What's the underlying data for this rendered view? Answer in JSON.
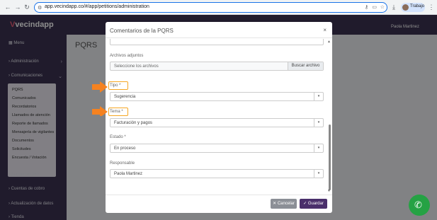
{
  "browser": {
    "url": "app.vecindapp.co/#/app/petitions/administration",
    "profile": "Trabajo"
  },
  "sidebar": {
    "logo": "vecindapp",
    "items": [
      {
        "label": "Menu"
      },
      {
        "label": "Administración"
      },
      {
        "label": "Comunicaciones"
      }
    ],
    "submenu": [
      "PQRS",
      "Comunicados",
      "Recordatorios",
      "Llamados de atención",
      "Reporte de llamados",
      "Mensajería de vigilantes",
      "Documentos",
      "Solicitudes",
      "Encuesta / Votación"
    ],
    "lower_items": [
      {
        "label": "Seguridad 360"
      },
      {
        "label": "Cuentas de cobro"
      },
      {
        "label": "Actualización de datos"
      },
      {
        "label": "Tienda"
      }
    ]
  },
  "main": {
    "page_title": "PQRS",
    "user_name": "Paola Martinez"
  },
  "modal": {
    "title": "Comentarios de la PQRS",
    "close": "×",
    "attachments_label": "Archivos adjuntos",
    "attachments_placeholder": "Seleccione los archivos",
    "attachments_button": "Buscar archivo",
    "tipo_label": "Tipo *",
    "tipo_value": "Sugerencia",
    "tema_label": "Tema *",
    "tema_value": "Facturación y pagos",
    "estado_label": "Estado *",
    "estado_value": "En proceso",
    "responsable_label": "Responsable",
    "responsable_value": "Paola Martinez",
    "cancel_label": "Cancelar",
    "save_label": "Guardar"
  },
  "colors": {
    "sidebar": "#3b3250",
    "highlight": "#f5a623",
    "save": "#4a2f6b",
    "cancel": "#8b8f96"
  }
}
